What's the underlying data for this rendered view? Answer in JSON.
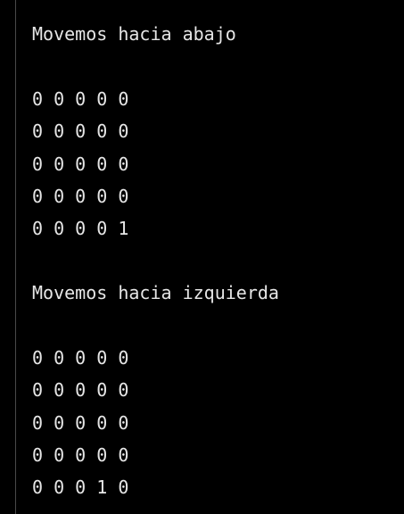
{
  "console": {
    "blocks": [
      {
        "heading": "Movemos hacia abajo",
        "rows": [
          "0 0 0 0 0",
          "0 0 0 0 0",
          "0 0 0 0 0",
          "0 0 0 0 0",
          "0 0 0 0 1"
        ]
      },
      {
        "heading": "Movemos hacia izquierda",
        "rows": [
          "0 0 0 0 0",
          "0 0 0 0 0",
          "0 0 0 0 0",
          "0 0 0 0 0",
          "0 0 0 1 0"
        ]
      }
    ]
  }
}
